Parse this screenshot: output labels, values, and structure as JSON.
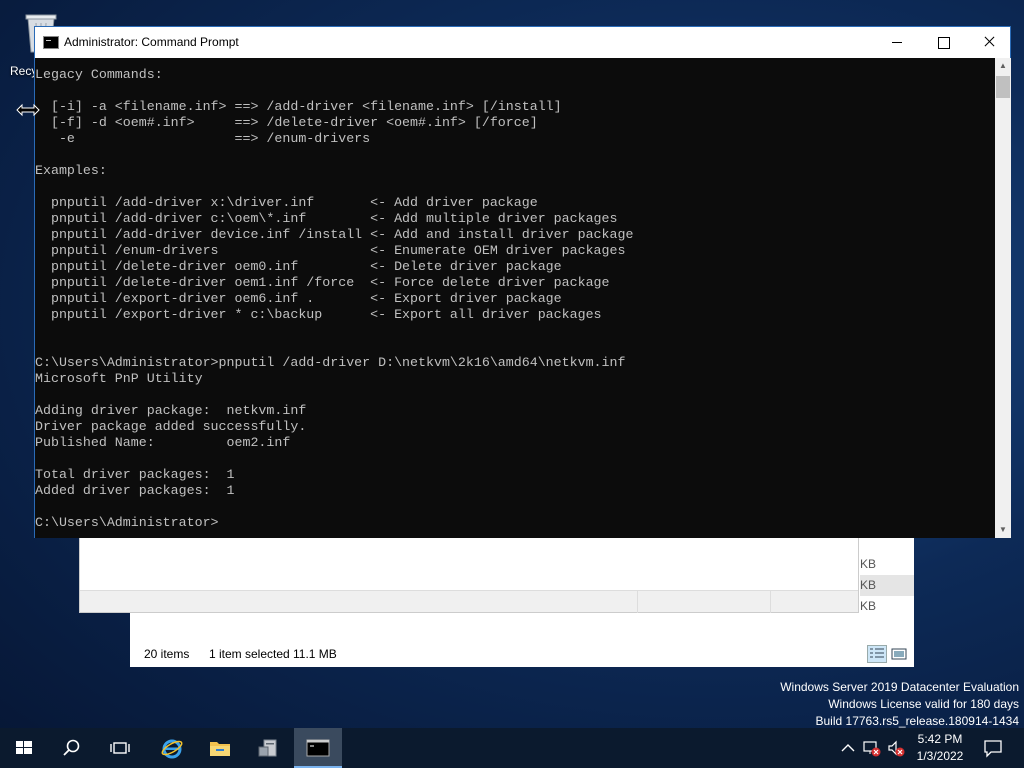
{
  "desktop": {
    "recycle_bin_label": "Recy"
  },
  "cmd": {
    "title": "Administrator: Command Prompt",
    "output": "\nLegacy Commands:\n\n  [-i] -a <filename.inf> ==> /add-driver <filename.inf> [/install]\n  [-f] -d <oem#.inf>     ==> /delete-driver <oem#.inf> [/force]\n   -e                    ==> /enum-drivers\n\nExamples:\n\n  pnputil /add-driver x:\\driver.inf       <- Add driver package\n  pnputil /add-driver c:\\oem\\*.inf        <- Add multiple driver packages\n  pnputil /add-driver device.inf /install <- Add and install driver package\n  pnputil /enum-drivers                   <- Enumerate OEM driver packages\n  pnputil /delete-driver oem0.inf         <- Delete driver package\n  pnputil /delete-driver oem1.inf /force  <- Force delete driver package\n  pnputil /export-driver oem6.inf .       <- Export driver package\n  pnputil /export-driver * c:\\backup      <- Export all driver packages\n\n\nC:\\Users\\Administrator>pnputil /add-driver D:\\netkvm\\2k16\\amd64\\netkvm.inf\nMicrosoft PnP Utility\n\nAdding driver package:  netkvm.inf\nDriver package added successfully.\nPublished Name:         oem2.inf\n\nTotal driver packages:  1\nAdded driver packages:  1\n\nC:\\Users\\Administrator>"
  },
  "explorer": {
    "size_unit_1": "KB",
    "size_unit_2": "KB",
    "size_unit_3": "KB",
    "item_count": "20 items",
    "selection": "1 item selected",
    "selection_size": "11.1 MB"
  },
  "watermark": {
    "line1": "Windows Server 2019 Datacenter Evaluation",
    "line2": "Windows License valid for 180 days",
    "line3": "Build 17763.rs5_release.180914-1434"
  },
  "taskbar": {
    "time": "5:42 PM",
    "date": "1/3/2022",
    "items": [
      "start-icon",
      "search-icon",
      "task-view-icon",
      "internet-explorer-icon",
      "file-explorer-icon",
      "server-manager-icon",
      "command-prompt-icon"
    ],
    "accent": "#7ab3ef"
  }
}
